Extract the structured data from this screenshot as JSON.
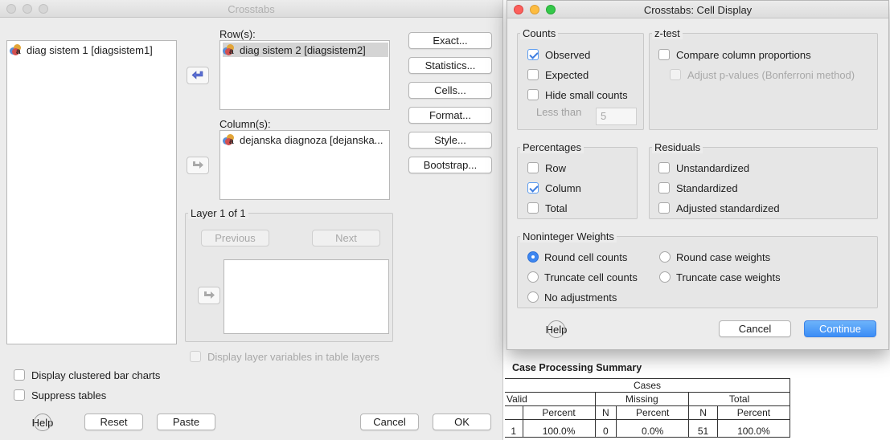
{
  "main_window": {
    "title": "Crosstabs",
    "source_list": [
      {
        "label": "diag sistem 1 [diagsistem1]"
      }
    ],
    "rows_label": "Row(s):",
    "rows_items": [
      {
        "label": "diag sistem 2 [diagsistem2]"
      }
    ],
    "columns_label": "Column(s):",
    "columns_items": [
      {
        "label": "dejanska diagnoza [dejanska..."
      }
    ],
    "side_buttons": {
      "exact": "Exact...",
      "statistics": "Statistics...",
      "cells": "Cells...",
      "format": "Format...",
      "style": "Style...",
      "bootstrap": "Bootstrap..."
    },
    "layer": {
      "title": "Layer 1 of 1",
      "previous": "Previous",
      "next": "Next"
    },
    "display_layer_vars": {
      "label": "Display layer variables in table layers",
      "checked": false
    },
    "display_clustered": {
      "label": "Display clustered bar charts",
      "checked": false
    },
    "suppress_tables": {
      "label": "Suppress tables",
      "checked": false
    },
    "bottom_buttons": {
      "help": "Help",
      "reset": "Reset",
      "paste": "Paste",
      "cancel": "Cancel",
      "ok": "OK"
    }
  },
  "cell_dialog": {
    "title": "Crosstabs: Cell Display",
    "counts": {
      "title": "Counts",
      "observed": {
        "label": "Observed",
        "checked": true
      },
      "expected": {
        "label": "Expected",
        "checked": false
      },
      "hide_small": {
        "label": "Hide small counts",
        "checked": false
      },
      "less_than_label": "Less than",
      "less_than_value": "5"
    },
    "ztest": {
      "title": "z-test",
      "compare": {
        "label": "Compare column proportions",
        "checked": false
      },
      "adjust": {
        "label": "Adjust p-values (Bonferroni method)",
        "checked": false
      }
    },
    "percentages": {
      "title": "Percentages",
      "row": {
        "label": "Row",
        "checked": false
      },
      "column": {
        "label": "Column",
        "checked": true
      },
      "total": {
        "label": "Total",
        "checked": false
      }
    },
    "residuals": {
      "title": "Residuals",
      "unstandardized": {
        "label": "Unstandardized",
        "checked": false
      },
      "standardized": {
        "label": "Standardized",
        "checked": false
      },
      "adjusted": {
        "label": "Adjusted standardized",
        "checked": false
      }
    },
    "noninteger": {
      "title": "Noninteger Weights",
      "round_cell": "Round cell counts",
      "round_case": "Round case weights",
      "truncate_cell": "Truncate cell counts",
      "truncate_case": "Truncate case weights",
      "no_adjust": "No adjustments",
      "selected": "round_cell"
    },
    "buttons": {
      "help": "Help",
      "cancel": "Cancel",
      "continue": "Continue"
    }
  },
  "output": {
    "case_summary_title": "Case Processing Summary",
    "header_cases": "Cases",
    "header_groups": [
      "Valid",
      "Missing",
      "Total"
    ],
    "header_cols": [
      "Percent",
      "N",
      "Percent",
      "N",
      "Percent"
    ],
    "row_partial": [
      "1",
      "100.0%",
      "0",
      "0.0%",
      "51",
      "100.0%"
    ]
  },
  "colors": {
    "accent_blue": "#3c8df6",
    "close_red": "#fc605c",
    "minimize_yellow": "#fdbc40",
    "zoom_green": "#34c84a"
  }
}
